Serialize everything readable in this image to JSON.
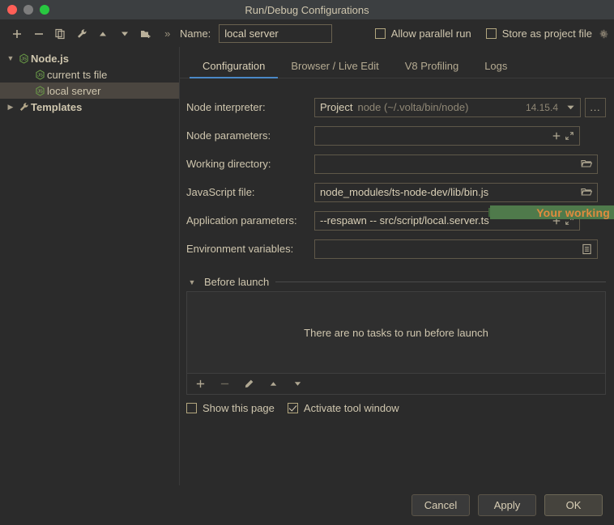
{
  "window": {
    "title": "Run/Debug Configurations",
    "traffic_lights": [
      "close",
      "minimize",
      "zoom"
    ]
  },
  "toolbar": {
    "icons": [
      {
        "name": "add-icon",
        "glyph": "+"
      },
      {
        "name": "remove-icon",
        "glyph": "−"
      },
      {
        "name": "copy-icon",
        "glyph": "copy"
      },
      {
        "name": "edit-templates-icon",
        "glyph": "wrench"
      },
      {
        "name": "move-up-icon",
        "glyph": "▲"
      },
      {
        "name": "move-down-icon",
        "glyph": "▼"
      },
      {
        "name": "new-folder-icon",
        "glyph": "folder-plus"
      },
      {
        "name": "overflow-icon",
        "glyph": "»"
      }
    ],
    "name_label": "Name:",
    "name_value": "local server",
    "name_placeholder": "Name",
    "allow_parallel_run": {
      "label": "Allow parallel run",
      "checked": false
    },
    "store_as_project_file": {
      "label": "Store as project file",
      "checked": false
    },
    "gear_icon": "gear-icon"
  },
  "sidebar": {
    "items": [
      {
        "label": "Node.js",
        "level": 0,
        "expanded": true,
        "bold": true,
        "icon": "nodejs-icon",
        "selected": false
      },
      {
        "label": "current ts file",
        "level": 2,
        "bold": false,
        "icon": "nodejs-icon",
        "selected": false
      },
      {
        "label": "local server",
        "level": 2,
        "bold": false,
        "icon": "nodejs-icon",
        "selected": true
      },
      {
        "label": "Templates",
        "level": 0,
        "expanded": false,
        "bold": true,
        "icon": "wrench-icon",
        "selected": false
      }
    ],
    "help_label": "?"
  },
  "tabs": [
    {
      "label": "Configuration",
      "active": true
    },
    {
      "label": "Browser / Live Edit",
      "active": false
    },
    {
      "label": "V8 Profiling",
      "active": false
    },
    {
      "label": "Logs",
      "active": false
    }
  ],
  "form": {
    "node_interpreter": {
      "label": "Node interpreter:",
      "prefix": "Project",
      "value": "node (~/.volta/bin/node)",
      "version": "14.15.4",
      "dropdown_icon": "chevron-down-icon",
      "browse_label": "..."
    },
    "node_parameters": {
      "label": "Node parameters:",
      "value": "",
      "placeholder": "",
      "icons": [
        "add-icon",
        "expand-icon"
      ]
    },
    "working_directory": {
      "label": "Working directory:",
      "value": "",
      "icons": [
        "folder-icon"
      ],
      "annotation": "Your working DIR"
    },
    "javascript_file": {
      "label": "JavaScript file:",
      "value": "node_modules/ts-node-dev/lib/bin.js",
      "icons": [
        "folder-icon"
      ]
    },
    "application_parameters": {
      "label": "Application parameters:",
      "value": "--respawn -- src/script/local.server.ts",
      "icons": [
        "add-icon",
        "expand-icon"
      ]
    },
    "environment_variables": {
      "label": "Environment variables:",
      "value": "",
      "icons": [
        "list-icon"
      ]
    }
  },
  "before_launch": {
    "title": "Before launch",
    "collapse_icon": "triangle-down-icon",
    "empty_message": "There are no tasks to run before launch",
    "tools": [
      {
        "name": "add-task-icon",
        "glyph": "+",
        "enabled": true
      },
      {
        "name": "remove-task-icon",
        "glyph": "−",
        "enabled": false
      },
      {
        "name": "edit-task-icon",
        "glyph": "pencil",
        "enabled": true
      },
      {
        "name": "move-task-up-icon",
        "glyph": "▲",
        "enabled": true
      },
      {
        "name": "move-task-down-icon",
        "glyph": "▼",
        "enabled": true
      }
    ],
    "show_this_page": {
      "label": "Show this page",
      "checked": false
    },
    "activate_tool_window": {
      "label": "Activate tool window",
      "checked": true
    }
  },
  "footer": {
    "cancel": "Cancel",
    "apply": "Apply",
    "ok": "OK"
  },
  "colors": {
    "background": "#2b2b2b",
    "titlebar": "#3c3f41",
    "text": "#cfc6ae",
    "accent_tab": "#4a88c7",
    "annotation_bg": "#4f7a4b",
    "annotation_text": "#e08b3e",
    "selection": "#4b4640",
    "node_green": "#7ba05b"
  }
}
